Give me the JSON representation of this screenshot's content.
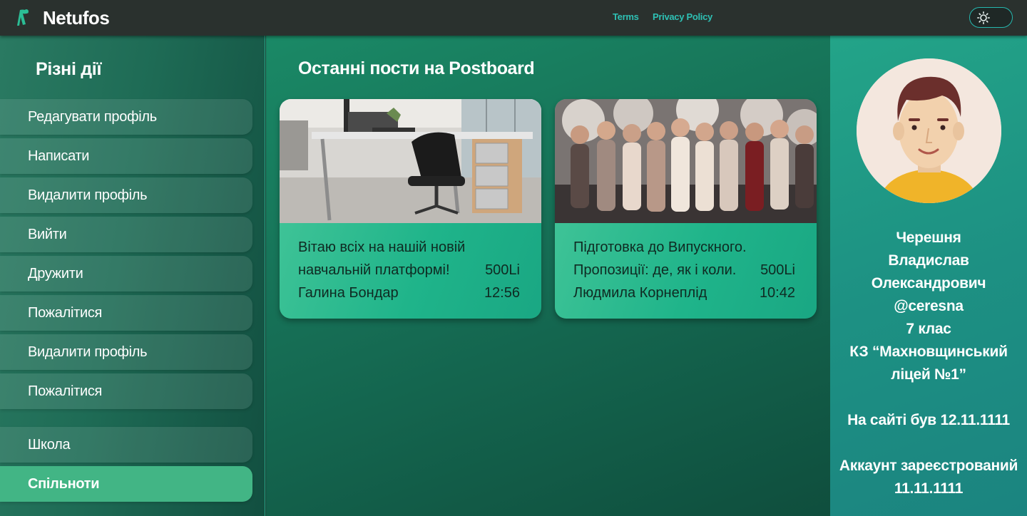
{
  "header": {
    "brand": "Netufos",
    "links": [
      "Terms",
      "Privacy Policy"
    ],
    "theme_icon": "sun-icon"
  },
  "sidebar": {
    "title": "Різні дії",
    "items": [
      {
        "label": "Редагувати профіль"
      },
      {
        "label": "Написати"
      },
      {
        "label": "Видалити профіль"
      },
      {
        "label": "Вийти"
      },
      {
        "label": "Дружити"
      },
      {
        "label": "Пожалітися"
      },
      {
        "label": "Видалити профіль"
      },
      {
        "label": "Пожалітися"
      },
      {
        "label": "Школа"
      },
      {
        "label": "Спільноти",
        "active": true
      }
    ]
  },
  "main": {
    "title": "Останні пости на Postboard",
    "posts": [
      {
        "line1": "Вітаю всіх на нашій новій",
        "line2": "навчальній платформі!",
        "size": "500Li",
        "author": "Галина Бондар",
        "time": "12:56"
      },
      {
        "line1": "Підготовка до Випускного.",
        "line2": "Пропозиції: де, як і коли.",
        "size": "500Li",
        "author": "Людмила Корнеплід",
        "time": "10:42"
      }
    ]
  },
  "profile": {
    "name1": "Черешня",
    "name2": "Владислав",
    "name3": "Олександрович",
    "username": "@ceresna",
    "grade": "7 клас",
    "school1": "КЗ “Махновщинський",
    "school2": "ліцей №1”",
    "last_seen": "На сайті був 12.11.1111",
    "registered_label": "Аккаунт зареєстрований",
    "registered_date": "11.11.1111"
  }
}
